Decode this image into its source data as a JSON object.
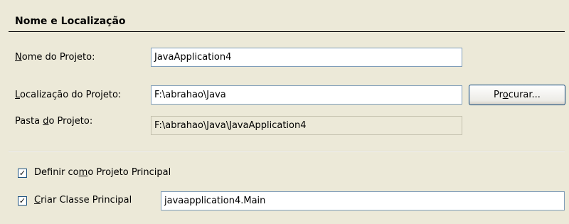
{
  "section": {
    "title": "Nome e Localização"
  },
  "project_name": {
    "label_pre": "",
    "label_ul": "N",
    "label_post": "ome do Projeto:",
    "value": "JavaApplication4"
  },
  "project_location": {
    "label_pre": "",
    "label_ul": "L",
    "label_post": "ocalização do Projeto:",
    "value": "F:\\abrahao\\Java"
  },
  "browse": {
    "label_pre": "Pr",
    "label_ul": "o",
    "label_post": "curar..."
  },
  "project_folder": {
    "label_pre": "Pasta ",
    "label_ul": "d",
    "label_post": "o Projeto:",
    "value": "F:\\abrahao\\Java\\JavaApplication4"
  },
  "main_project": {
    "checked": true,
    "check_glyph": "✓",
    "label_pre": "Definir co",
    "label_ul": "m",
    "label_post": "o Projeto Principal"
  },
  "main_class": {
    "checked": true,
    "check_glyph": "✓",
    "label_pre": "",
    "label_ul": "C",
    "label_post": "riar Classe Principal",
    "value": "javaapplication4.Main"
  }
}
